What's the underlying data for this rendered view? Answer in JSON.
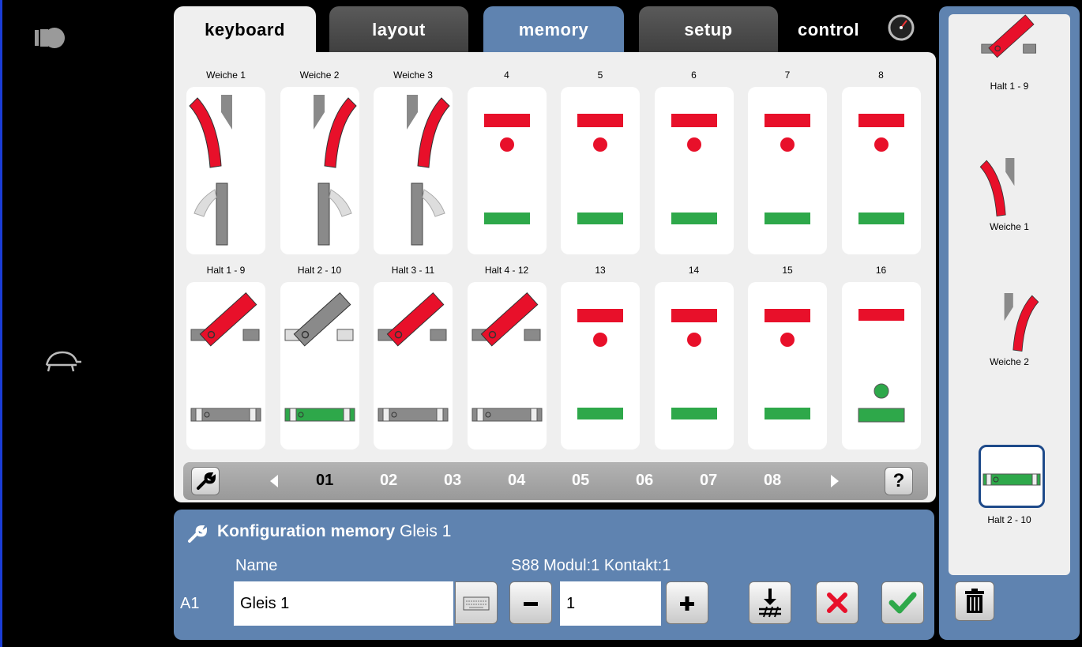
{
  "tabs": {
    "keyboard": "keyboard",
    "layout": "layout",
    "memory": "memory",
    "setup": "setup",
    "control": "control"
  },
  "keyboard": {
    "row1": [
      {
        "label": "Weiche 1",
        "type": "turnout-left"
      },
      {
        "label": "Weiche 2",
        "type": "turnout-right"
      },
      {
        "label": "Weiche 3",
        "type": "turnout-right"
      },
      {
        "label": "4",
        "type": "signal"
      },
      {
        "label": "5",
        "type": "signal"
      },
      {
        "label": "6",
        "type": "signal"
      },
      {
        "label": "7",
        "type": "signal"
      },
      {
        "label": "8",
        "type": "signal"
      }
    ],
    "row2": [
      {
        "label": "Halt 1 - 9",
        "type": "uncoupler-red"
      },
      {
        "label": "Halt 2 - 10",
        "type": "uncoupler-green"
      },
      {
        "label": "Halt 3 - 11",
        "type": "uncoupler-red"
      },
      {
        "label": "Halt 4 - 12",
        "type": "uncoupler-red"
      },
      {
        "label": "13",
        "type": "signal"
      },
      {
        "label": "14",
        "type": "signal"
      },
      {
        "label": "15",
        "type": "signal"
      },
      {
        "label": "16",
        "type": "signal-green"
      }
    ]
  },
  "pager": {
    "pages": [
      "01",
      "02",
      "03",
      "04",
      "05",
      "06",
      "07",
      "08"
    ],
    "active": "01",
    "help_label": "?"
  },
  "config": {
    "title_bold": "Konfiguration memory",
    "title_rest": " Gleis 1",
    "name_label": "Name",
    "s88_label": "S88 Modul:1 Kontakt:1",
    "row_label": "A1",
    "name_value": "Gleis 1",
    "contact_value": "1"
  },
  "memory_list": [
    {
      "label": "Halt 1 - 9",
      "type": "uncoupler-red"
    },
    {
      "label": "Weiche 1",
      "type": "turnout-left"
    },
    {
      "label": "Weiche 2",
      "type": "turnout-right"
    },
    {
      "label": "Halt 2 - 10",
      "type": "uncoupler-green"
    }
  ],
  "colors": {
    "accent_blue": "#5f83b0",
    "signal_red": "#e8102a",
    "signal_green": "#2ea84a",
    "track_grey": "#8a8a8a"
  }
}
